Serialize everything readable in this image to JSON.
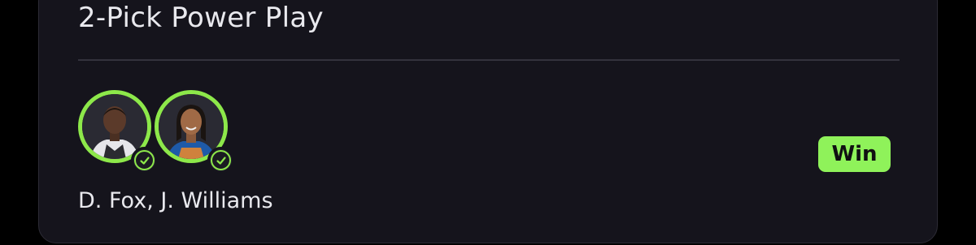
{
  "entry": {
    "title": "2-Pick Power Play",
    "players_label": "D. Fox, J. Williams",
    "result_label": "Win"
  },
  "players": [
    {
      "name": "D. Fox",
      "avatar_icon": "player-photo-icon",
      "status_icon": "check-circle-icon",
      "status": "hit"
    },
    {
      "name": "J. Williams",
      "avatar_icon": "player-photo-icon",
      "status_icon": "check-circle-icon",
      "status": "hit"
    }
  ],
  "colors": {
    "background": "#000000",
    "card": "#15141c",
    "accent_green": "#8de84a",
    "badge_green": "#8ff25a",
    "text": "#e9e9ee"
  }
}
